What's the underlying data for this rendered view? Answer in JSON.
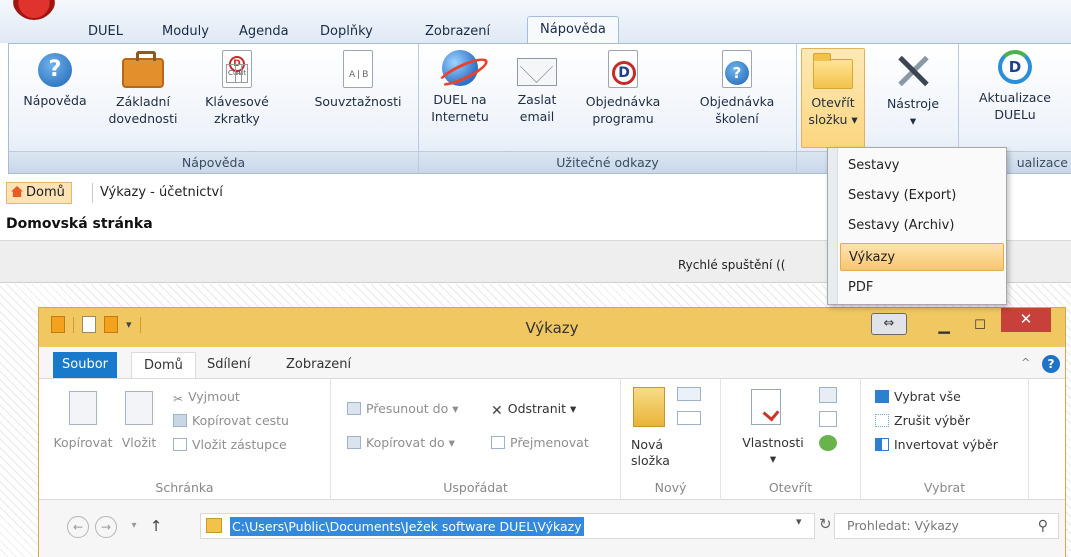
{
  "app": {
    "tabs": [
      "DUEL",
      "Moduly",
      "Agenda",
      "Doplňky",
      "Zobrazení",
      "Nápověda"
    ],
    "active_tab": "Nápověda"
  },
  "ribbon": {
    "groups": [
      {
        "label": "Nápověda",
        "buttons": [
          "Nápověda",
          "Základní\ndovednosti",
          "Klávesové\nzkratky",
          "Souvztažnosti"
        ]
      },
      {
        "label": "Užitečné odkazy",
        "buttons": [
          "DUEL na\nInternetu",
          "Zaslat\nemail",
          "Objednávka\nprogramu",
          "Objednávka\nškolení"
        ]
      },
      {
        "label": "",
        "buttons": [
          "Otevřít\nsložku ▾",
          "Nástroje\n▾"
        ]
      },
      {
        "label": "ualizace",
        "buttons": [
          "Aktualizace\nDUELu"
        ]
      }
    ]
  },
  "dropdown": {
    "items": [
      "Sestavy",
      "Sestavy (Export)",
      "Sestavy (Archiv)",
      "Výkazy",
      "PDF"
    ],
    "highlighted": "Výkazy"
  },
  "breadcrumb": {
    "home": "Domů",
    "current": "Výkazy - účetnictví"
  },
  "page": {
    "title": "Domovská stránka",
    "quick_launch_label": "Rychlé spuštění (("
  },
  "explorer": {
    "title": "Výkazy",
    "snap_icon": "⇔",
    "tabs": [
      "Soubor",
      "Domů",
      "Sdílení",
      "Zobrazení"
    ],
    "groups": {
      "clipboard": {
        "label": "Schránka",
        "copy": "Kopírovat",
        "paste": "Vložit",
        "cut": "Vyjmout",
        "copy_path": "Kopírovat cestu",
        "paste_shortcut": "Vložit zástupce"
      },
      "organize": {
        "label": "Uspořádat",
        "move_to": "Přesunout do ▾",
        "copy_to": "Kopírovat do ▾",
        "delete": "Odstranit ▾",
        "rename": "Přejmenovat"
      },
      "new": {
        "label": "Nový",
        "new_folder": "Nová\nsložka"
      },
      "open": {
        "label": "Otevřít",
        "properties": "Vlastnosti\n▾"
      },
      "select": {
        "label": "Vybrat",
        "select_all": "Vybrat vše",
        "select_none": "Zrušit výběr",
        "invert": "Invertovat výběr"
      }
    },
    "address_path": "C:\\Users\\Public\\Documents\\Ježek software DUEL\\Výkazy",
    "search_placeholder": "Prohledat: Výkazy"
  },
  "colors": {
    "explorer_titlebar": "#f1c761",
    "close_button": "#c7403a",
    "file_tab": "#1979ca",
    "address_selection": "#3389dd",
    "menu_highlight": "#f8c670"
  }
}
